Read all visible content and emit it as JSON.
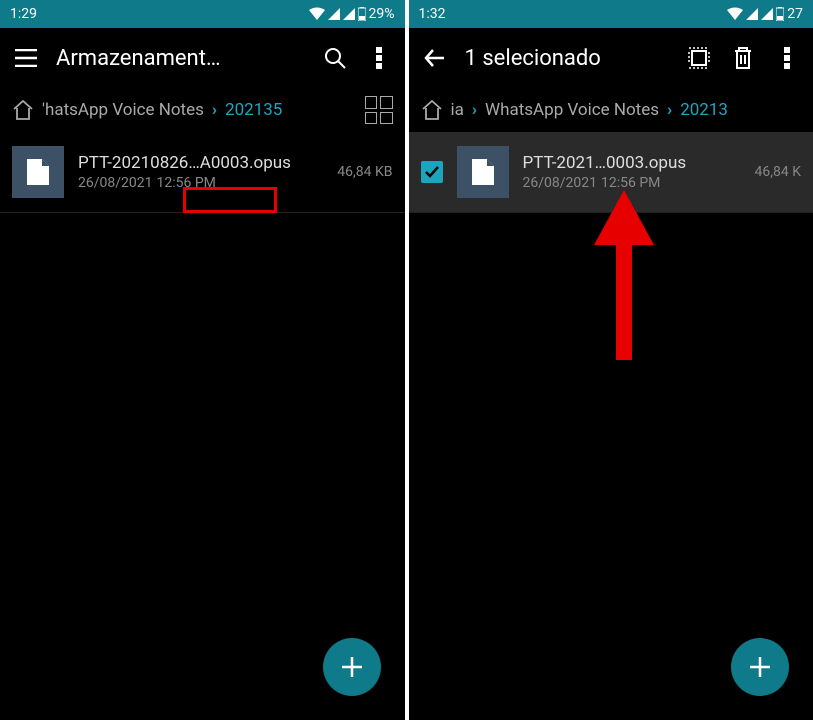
{
  "left": {
    "status": {
      "time": "1:29",
      "battery": "29%"
    },
    "app_bar": {
      "title": "Armazenament…"
    },
    "breadcrumb": {
      "seg1": "'hatsApp Voice Notes",
      "seg2": "202135"
    },
    "file": {
      "name": "PTT-20210826…A0003.opus",
      "date": "26/08/2021",
      "time": "12:56 PM",
      "size": "46,84 KB"
    }
  },
  "right": {
    "status": {
      "time": "1:32",
      "battery": "27"
    },
    "app_bar": {
      "title": "1 selecionado"
    },
    "breadcrumb": {
      "seg0": "ia",
      "seg1": "WhatsApp Voice Notes",
      "seg2": "20213"
    },
    "file": {
      "name": "PTT-2021…0003.opus",
      "date": "26/08/2021",
      "time": "12:56 PM",
      "size": "46,84 K"
    }
  }
}
